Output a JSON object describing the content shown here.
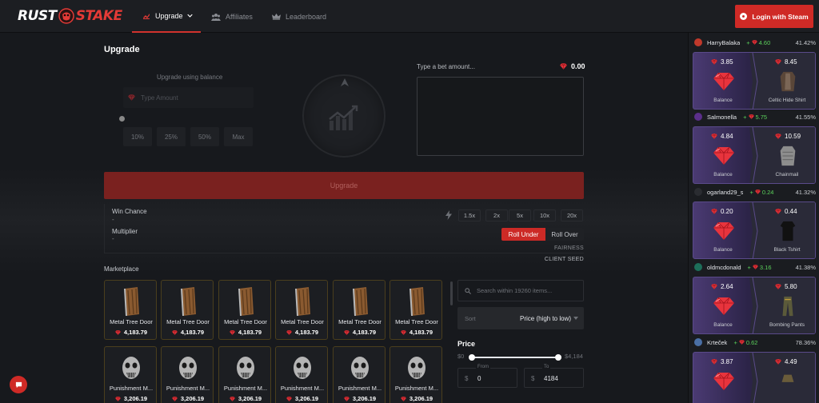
{
  "header": {
    "logo_left": "RUST",
    "logo_right": "STAKE",
    "nav": [
      {
        "label": "Upgrade",
        "icon": "upgrade-icon"
      },
      {
        "label": "Affiliates",
        "icon": "users-icon"
      },
      {
        "label": "Leaderboard",
        "icon": "crown-icon"
      }
    ],
    "login_label": "Login with Steam"
  },
  "upgrade": {
    "title": "Upgrade",
    "balance_label": "Upgrade using balance",
    "amount_placeholder": "Type Amount",
    "percent_buttons": [
      "10%",
      "25%",
      "50%",
      "Max"
    ],
    "bet_label": "Type a bet amount...",
    "bet_value": "0.00",
    "upgrade_button": "Upgrade",
    "win_chance_label": "Win Chance",
    "win_chance_value": "-",
    "multiplier_label": "Multiplier",
    "multiplier_value": "-",
    "multipliers": [
      "1.5x",
      "2x",
      "5x",
      "10x",
      "20x"
    ],
    "roll_under": "Roll Under",
    "roll_over": "Roll Over",
    "fairness": "FAIRNESS",
    "client_seed": "CLIENT SEED"
  },
  "marketplace": {
    "title": "Marketplace",
    "items": [
      {
        "name": "Metal Tree Door",
        "price": "4,183.79"
      },
      {
        "name": "Metal Tree Door",
        "price": "4,183.79"
      },
      {
        "name": "Metal Tree Door",
        "price": "4,183.79"
      },
      {
        "name": "Metal Tree Door",
        "price": "4,183.79"
      },
      {
        "name": "Metal Tree Door",
        "price": "4,183.79"
      },
      {
        "name": "Metal Tree Door",
        "price": "4,183.79"
      },
      {
        "name": "Punishment M...",
        "price": "3,206.19"
      },
      {
        "name": "Punishment M...",
        "price": "3,206.19"
      },
      {
        "name": "Punishment M...",
        "price": "3,206.19"
      },
      {
        "name": "Punishment M...",
        "price": "3,206.19"
      },
      {
        "name": "Punishment M...",
        "price": "3,206.19"
      },
      {
        "name": "Punishment M...",
        "price": "3,206.19"
      }
    ]
  },
  "filters": {
    "search_placeholder": "Search within 19260 items...",
    "sort_label": "Sort",
    "sort_value": "Price (high to low)",
    "price_title": "Price",
    "price_min_label": "$0",
    "price_max_label": "$4,184",
    "from_label": "From",
    "to_label": "To",
    "currency": "$",
    "from_value": "0",
    "to_value": "4184"
  },
  "feed": [
    {
      "user": "HarryBalaka",
      "profit": "4.60",
      "pct": "41.42%",
      "bet": "3.85",
      "win": "8.45",
      "bet_label": "Balance",
      "item": "Celtic Hide Shirt"
    },
    {
      "user": "Salmonella",
      "profit": "5.75",
      "pct": "41.55%",
      "bet": "4.84",
      "win": "10.59",
      "bet_label": "Balance",
      "item": "Chainmail"
    },
    {
      "user": "ogarland29_s",
      "profit": "0.24",
      "pct": "41.32%",
      "bet": "0.20",
      "win": "0.44",
      "bet_label": "Balance",
      "item": "Black Tshirt"
    },
    {
      "user": "oldmcdonald",
      "profit": "3.16",
      "pct": "41.38%",
      "bet": "2.64",
      "win": "5.80",
      "bet_label": "Balance",
      "item": "Bombing Pants"
    },
    {
      "user": "Krteček",
      "profit": "0.62",
      "pct": "78.36%",
      "bet": "3.87",
      "win": "4.49",
      "bet_label": "",
      "item": ""
    }
  ],
  "colors": {
    "accent": "#cf2a26",
    "profit": "#5bd15b",
    "gem": "#e0323a",
    "card_border": "#4a3e1d"
  }
}
